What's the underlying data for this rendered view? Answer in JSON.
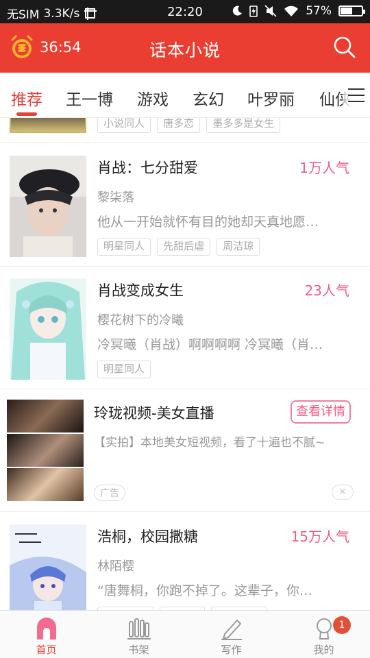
{
  "status_bar": {
    "carrier": "无SIM",
    "speed": "3.3K/s",
    "time": "22:20",
    "battery": "57%",
    "battery_level": 0.57
  },
  "header": {
    "timer": "36:54",
    "title": "话本小说",
    "accent_color": "#ea3e32"
  },
  "tabs": [
    {
      "label": "推荐",
      "active": true
    },
    {
      "label": "王一博",
      "active": false
    },
    {
      "label": "游戏",
      "active": false
    },
    {
      "label": "玄幻",
      "active": false
    },
    {
      "label": "叶罗丽",
      "active": false
    },
    {
      "label": "仙侠",
      "active": false
    }
  ],
  "partial_item": {
    "tags": [
      "小说同人",
      "唐多恋",
      "墨多多是女生"
    ]
  },
  "books": [
    {
      "title": "肖战：七分甜爱",
      "popularity": "1万人气",
      "author": "黎柒落",
      "description": "他从一开始就怀有目的她却天真地愿…",
      "tags": [
        "明星同人",
        "先甜后虐",
        "周洁琼"
      ]
    },
    {
      "title": "肖战变成女生",
      "popularity": "23人气",
      "author": "樱花树下的冷曦",
      "description": "冷冥曦（肖战）啊啊啊啊 冷冥曦（肖…",
      "tags": [
        "明星同人"
      ]
    },
    {
      "title": "浩桐，校园撒糖",
      "popularity": "15万人气",
      "author": "林陌樱",
      "description": "“唐舞桐，你跑不掉了。这辈子，你…",
      "tags": [
        "",
        "",
        ""
      ]
    }
  ],
  "ad": {
    "title": "玲珑视频-美女直播",
    "detail_button": "查看详情",
    "description": "【实拍】本地美女短视频，看了十遍也不腻~",
    "label": "广告",
    "close": "✕"
  },
  "bottom_nav": [
    {
      "label": "首页",
      "icon": "home-icon",
      "active": true
    },
    {
      "label": "书架",
      "icon": "bookshelf-icon",
      "active": false
    },
    {
      "label": "写作",
      "icon": "pencil-icon",
      "active": false
    },
    {
      "label": "我的",
      "icon": "profile-icon",
      "active": false,
      "badge": "1"
    }
  ]
}
